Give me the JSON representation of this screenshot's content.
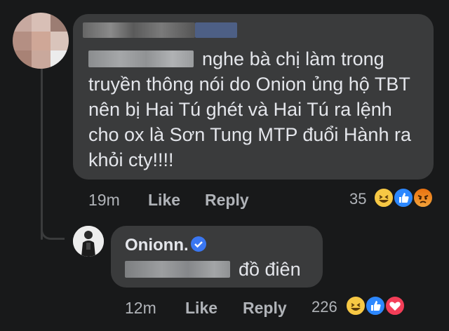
{
  "comment": {
    "text": "nghe bà chị làm trong truyền thông nói do Onion ủng hộ TBT nên bị Hai Tú ghét và Hai Tú ra lệnh cho ox là Sơn Tung MTP đuổi Hành ra khỏi cty!!!!",
    "time": "19m",
    "like_label": "Like",
    "reply_label": "Reply",
    "reaction_count": "35",
    "reactions": [
      "haha-icon",
      "like-icon",
      "angry-icon"
    ]
  },
  "reply": {
    "author": "Onionn.",
    "verified": true,
    "text": "đồ điên",
    "time": "12m",
    "like_label": "Like",
    "reply_label": "Reply",
    "reaction_count": "226",
    "reactions": [
      "haha-icon",
      "like-icon",
      "love-icon"
    ]
  },
  "colors": {
    "background": "#18191a",
    "bubble": "#3a3b3c",
    "text": "#e4e6eb",
    "secondary_text": "#b0b3b8",
    "like_blue": "#2d88ff",
    "haha_yellow": "#f7c844",
    "angry_orange": "#e9710f",
    "love_red": "#f33e58",
    "verified_blue": "#3a77f2"
  }
}
